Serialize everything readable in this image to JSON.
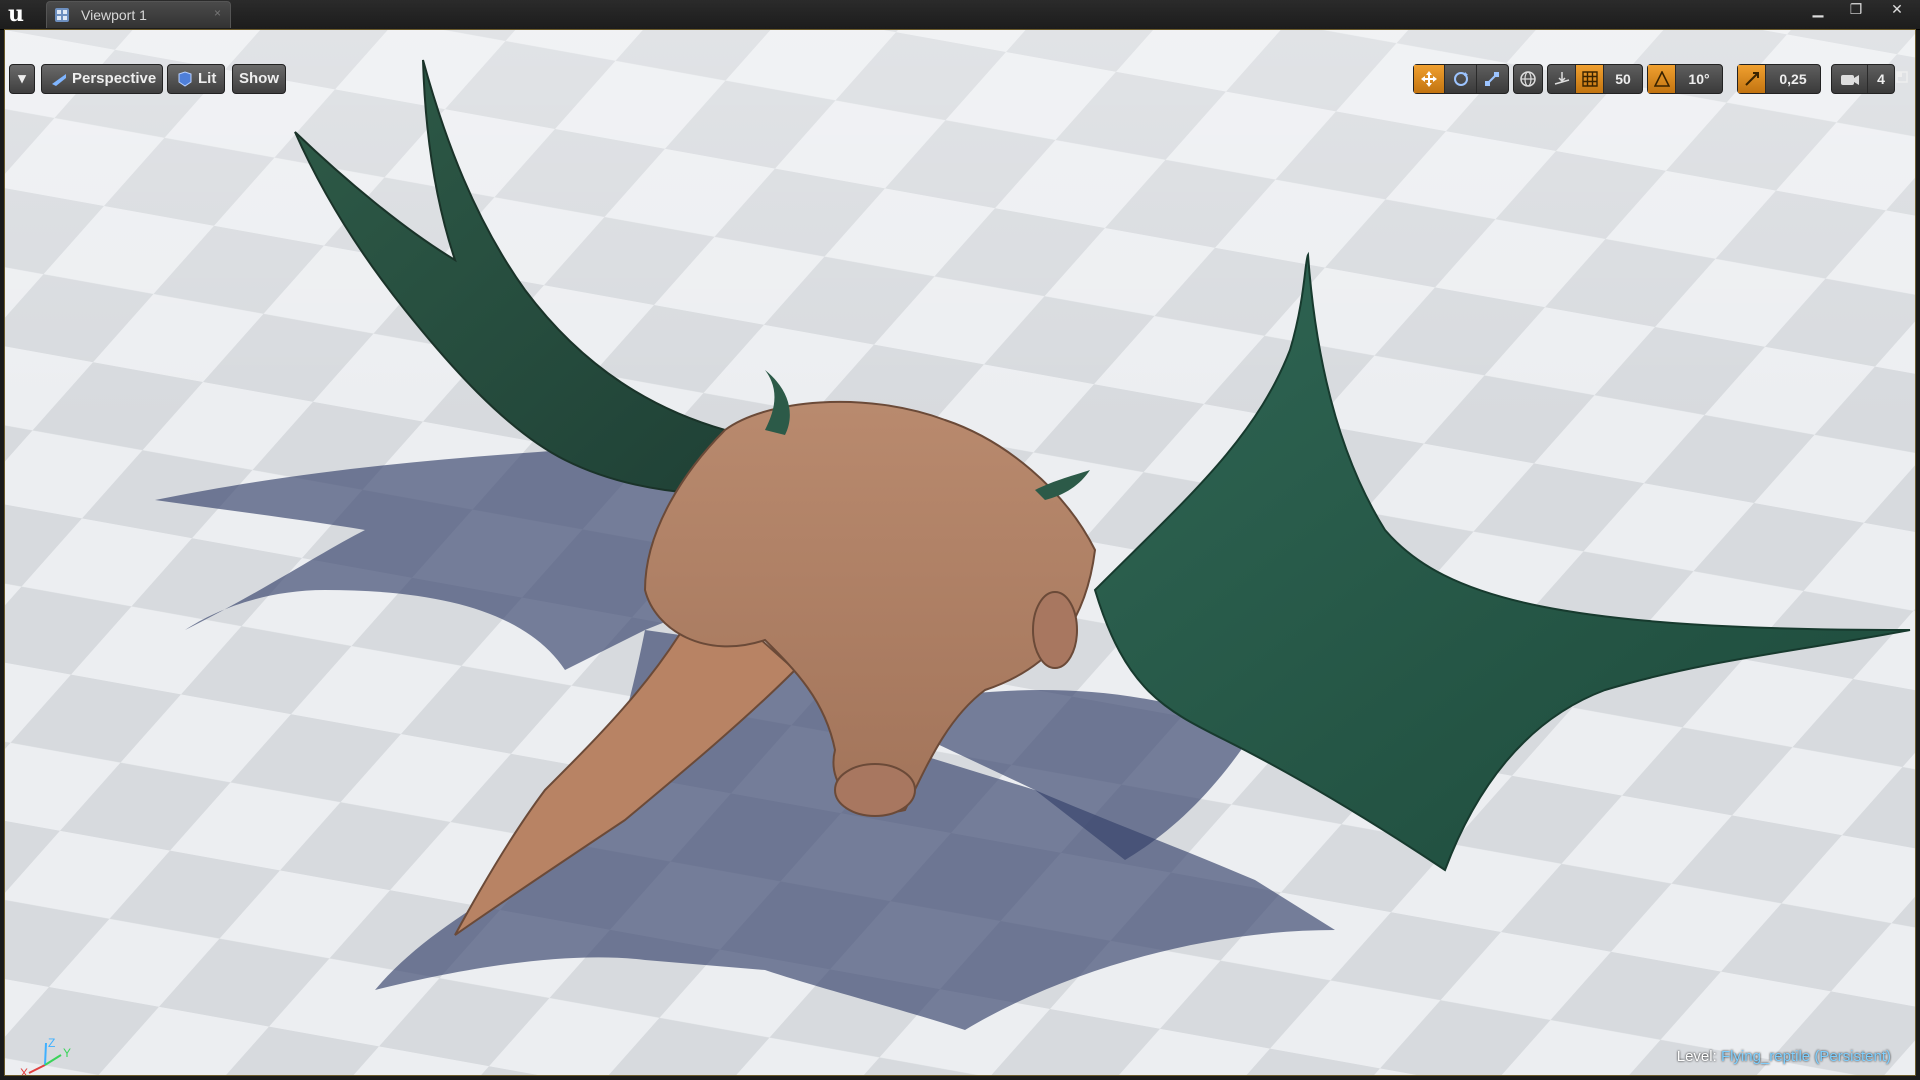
{
  "window": {
    "tab_title": "Viewport 1",
    "tab_close": "×",
    "minimize": "▁",
    "restore": "❐",
    "close": "✕"
  },
  "toolbar": {
    "options_dropdown": "▾",
    "perspective_label": "Perspective",
    "lit_label": "Lit",
    "show_label": "Show",
    "grid_snap_value": "50",
    "rotation_snap_value": "10°",
    "scale_snap_value": "0,25",
    "camera_speed_value": "4",
    "active_color": "#e8901c"
  },
  "viewport": {
    "level_label": "Level:",
    "level_name": "Flying_reptile (Persistent)",
    "axis_x": "X",
    "axis_y": "Y",
    "axis_z": "Z"
  }
}
